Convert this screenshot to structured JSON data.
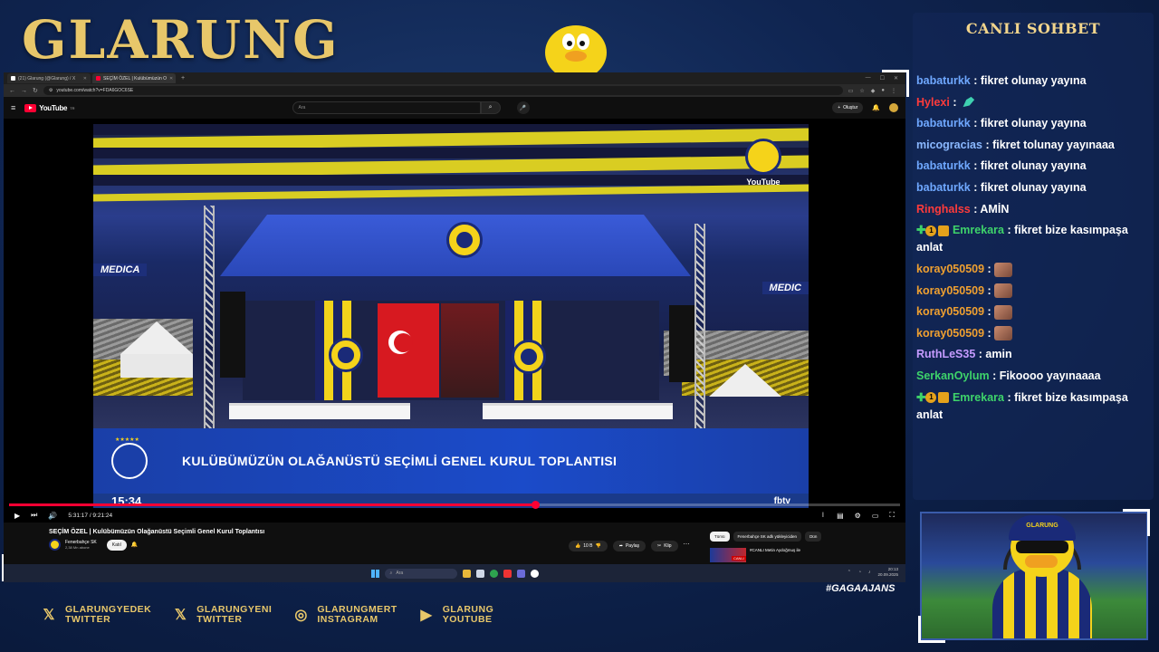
{
  "overlay": {
    "brand": "GLARUNG",
    "hashtag": "#GAGAAJANS"
  },
  "browser": {
    "tabs": [
      {
        "label": "(21) Glarung (@Glarung) / X",
        "active": false
      },
      {
        "label": "SEÇİM ÖZEL | Kulübümüzün O",
        "active": true
      }
    ],
    "url": "youtube.com/watch?v=FDA6GOC6SE"
  },
  "youtube": {
    "logo": "YouTube",
    "region": "TR",
    "search_placeholder": "Ara",
    "create_label": "Oluştur"
  },
  "video": {
    "lower_third_title": "KULÜBÜMÜZÜN OLAĞANÜSTÜ SEÇİMLİ GENEL KURUL TOPLANTISI",
    "clock": "15:34",
    "channel_tag": "fbtv",
    "badge": "YouTube",
    "sponsor_left": "MEDICA",
    "sponsor_right": "MEDIC",
    "time_current": "5:31:17",
    "time_total": "9:21:24",
    "time_display": "5:31:17 / 9:21:24",
    "progress": 0.59
  },
  "below": {
    "title": "SEÇİM ÖZEL | Kulübümüzün Olağanüstü Seçimli Genel Kurul Toplantısı",
    "channel": "Fenerbahçe SK",
    "subs": "2,38 Mn abone",
    "join": "Katıl",
    "likes": "10 B",
    "share": "Paylaş",
    "clip": "Klip",
    "chips": [
      {
        "label": "Tümü",
        "active": true
      },
      {
        "label": "Fenerbahçe SK adlı yükleyiciden",
        "active": false
      },
      {
        "label": "Dün",
        "active": false
      }
    ],
    "rec_title": "#CANLI Metin Aydoğmuş ile",
    "rec_badge": "CANLI"
  },
  "taskbar": {
    "search": "Ara",
    "time": "20:13",
    "date": "20.09.2025"
  },
  "chat": {
    "header": "CANLI SOHBET",
    "messages": [
      {
        "user": "babaturkk",
        "color": "#6fa8ff",
        "text": "fikret olunay yayına"
      },
      {
        "user": "Hylexi",
        "color": "#ff3b3b",
        "text": "",
        "emote": "teal"
      },
      {
        "user": "babaturkk",
        "color": "#6fa8ff",
        "text": "fikret olunay yayına"
      },
      {
        "user": "micogracias",
        "color": "#8ab8ff",
        "text": "fikret tolunay yayınaaa"
      },
      {
        "user": "babaturkk",
        "color": "#6fa8ff",
        "text": "fikret olunay yayına"
      },
      {
        "user": "babaturkk",
        "color": "#6fa8ff",
        "text": "fikret olunay yayına"
      },
      {
        "user": "Ringhalss",
        "color": "#ff3b3b",
        "text": "AMİN"
      },
      {
        "user": "Emrekara",
        "color": "#3ed36a",
        "text": "fikret bize kasımpaşa anlat",
        "badges": true
      },
      {
        "user": "koray050509",
        "color": "#f0a030",
        "text": "",
        "emote": "face"
      },
      {
        "user": "koray050509",
        "color": "#f0a030",
        "text": "",
        "emote": "face"
      },
      {
        "user": "koray050509",
        "color": "#f0a030",
        "text": "",
        "emote": "face"
      },
      {
        "user": "koray050509",
        "color": "#f0a030",
        "text": "",
        "emote": "face"
      },
      {
        "user": "RuthLeS35",
        "color": "#c59bff",
        "text": "amin"
      },
      {
        "user": "SerkanOylum",
        "color": "#3ed36a",
        "text": "Fikoooo yayınaaaa"
      },
      {
        "user": "Emrekara",
        "color": "#3ed36a",
        "text": "fikret bize kasımpaşa anlat",
        "badges": true
      }
    ]
  },
  "webcam": {
    "cap_text": "GLARUNG"
  },
  "socials": [
    {
      "icon": "x-icon",
      "line1": "GLARUNGYEDEK",
      "line2": "TWITTER"
    },
    {
      "icon": "x-icon",
      "line1": "GLARUNGYENI",
      "line2": "TWITTER"
    },
    {
      "icon": "instagram-icon",
      "line1": "GLARUNGMERT",
      "line2": "INSTAGRAM"
    },
    {
      "icon": "youtube-icon",
      "line1": "GLARUNG",
      "line2": "YOUTUBE"
    }
  ]
}
